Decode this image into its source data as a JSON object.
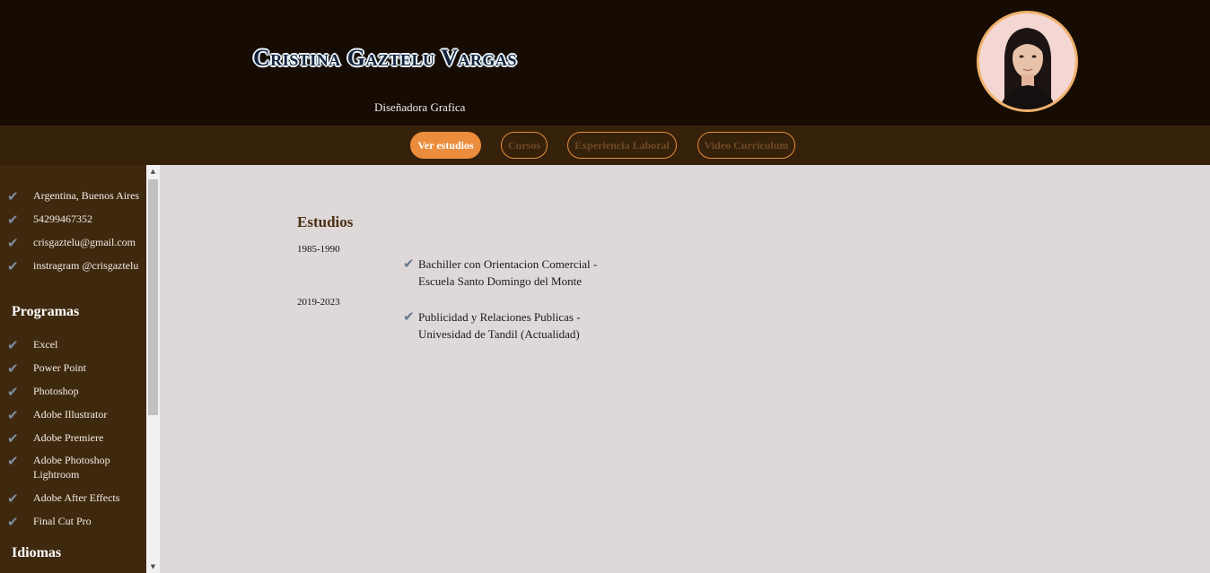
{
  "header": {
    "name": "Cristina Gaztelu Vargas",
    "subtitle": "Diseñadora Grafica"
  },
  "nav": {
    "tabs": [
      {
        "label": "Ver estudios",
        "active": true
      },
      {
        "label": "Cursos",
        "active": false
      },
      {
        "label": "Experiencia Laboral",
        "active": false
      },
      {
        "label": "Video Curriculum",
        "active": false
      }
    ]
  },
  "sidebar": {
    "contact": [
      "Argentina, Buenos Aires",
      "54299467352",
      "crisgaztelu@gmail.com",
      "instragram @crisgaztelu"
    ],
    "programs_heading": "Programas",
    "programs": [
      "Excel",
      "Power Point",
      "Photoshop",
      "Adobe Illustrator",
      "Adobe Premiere",
      "Adobe Photoshop Lightroom",
      "Adobe After Effects",
      "Final Cut Pro"
    ],
    "languages_heading": "Idiomas",
    "check_icon": "check-icon"
  },
  "main": {
    "section_title": "Estudios",
    "studies": [
      {
        "years": "1985-1990",
        "text": "Bachiller con Orientacion Comercial - Escuela Santo Domingo del Monte"
      },
      {
        "years": "2019-2023",
        "text": "Publicidad y Relaciones Publicas - Univesidad de Tandil (Actualidad)"
      }
    ]
  },
  "colors": {
    "header_bg": "#160c04",
    "nav_bg": "#36210b",
    "sidebar_bg": "#3f290e",
    "accent": "#eb8d3c",
    "content_bg": "#dfd8d9"
  }
}
